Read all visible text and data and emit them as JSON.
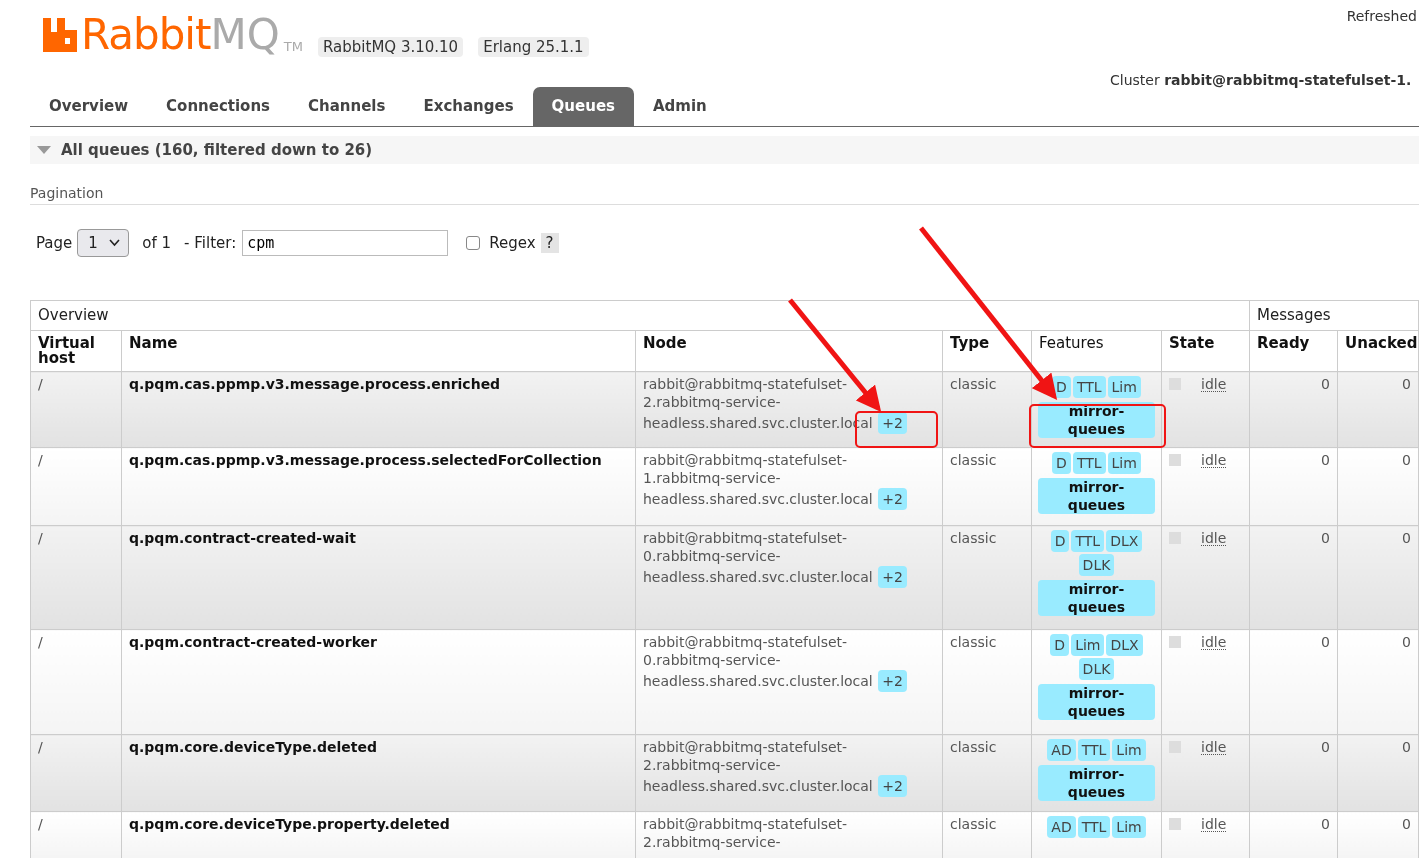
{
  "header": {
    "logo": {
      "brand": "Rabbit",
      "product": "MQ",
      "tm": "TM"
    },
    "versions": [
      "RabbitMQ 3.10.10",
      "Erlang 25.1.1"
    ],
    "refreshed": "Refreshed",
    "cluster_label": "Cluster",
    "cluster_name": "rabbit@rabbitmq-statefulset-1."
  },
  "tabs": [
    {
      "label": "Overview",
      "selected": false
    },
    {
      "label": "Connections",
      "selected": false
    },
    {
      "label": "Channels",
      "selected": false
    },
    {
      "label": "Exchanges",
      "selected": false
    },
    {
      "label": "Queues",
      "selected": true
    },
    {
      "label": "Admin",
      "selected": false
    }
  ],
  "section": {
    "title": "All queues (160, filtered down to 26)",
    "expanded": true
  },
  "pagination": {
    "heading": "Pagination",
    "page_label": "Page",
    "page_value": "1",
    "of_label": "of 1",
    "filter_label": "- Filter:",
    "filter_value": "cpm",
    "regex_label": "Regex",
    "regex_checked": false,
    "help": "?"
  },
  "table": {
    "groups": [
      {
        "label": "Overview"
      },
      {
        "label": "Messages"
      }
    ],
    "columns": [
      {
        "label": "Virtual host",
        "bold": true
      },
      {
        "label": "Name",
        "bold": true
      },
      {
        "label": "Node",
        "bold": true
      },
      {
        "label": "Type",
        "bold": true
      },
      {
        "label": "Features",
        "bold": false
      },
      {
        "label": "State",
        "bold": true
      },
      {
        "label": "Ready",
        "bold": true
      },
      {
        "label": "Unacked",
        "bold": true
      }
    ],
    "rows": [
      {
        "vhost": "/",
        "name": "q.pqm.cas.ppmp.v3.message.process.enriched",
        "node": "rabbit@rabbitmq-statefulset-2.rabbitmq-service-headless.shared.svc.cluster.local",
        "node_extra": "+2",
        "type": "classic",
        "features": [
          "D",
          "TTL",
          "Lim"
        ],
        "policy": "mirror-queues",
        "state": "idle",
        "ready": "0",
        "unacked": "0"
      },
      {
        "vhost": "/",
        "name": "q.pqm.cas.ppmp.v3.message.process.selectedForCollection",
        "node": "rabbit@rabbitmq-statefulset-1.rabbitmq-service-headless.shared.svc.cluster.local",
        "node_extra": "+2",
        "type": "classic",
        "features": [
          "D",
          "TTL",
          "Lim"
        ],
        "policy": "mirror-queues",
        "state": "idle",
        "ready": "0",
        "unacked": "0"
      },
      {
        "vhost": "/",
        "name": "q.pqm.contract-created-wait",
        "node": "rabbit@rabbitmq-statefulset-0.rabbitmq-service-headless.shared.svc.cluster.local",
        "node_extra": "+2",
        "type": "classic",
        "features": [
          "D",
          "TTL",
          "DLX",
          "DLK"
        ],
        "policy": "mirror-queues",
        "state": "idle",
        "ready": "0",
        "unacked": "0"
      },
      {
        "vhost": "/",
        "name": "q.pqm.contract-created-worker",
        "node": "rabbit@rabbitmq-statefulset-0.rabbitmq-service-headless.shared.svc.cluster.local",
        "node_extra": "+2",
        "type": "classic",
        "features": [
          "D",
          "Lim",
          "DLX",
          "DLK"
        ],
        "policy": "mirror-queues",
        "state": "idle",
        "ready": "0",
        "unacked": "0"
      },
      {
        "vhost": "/",
        "name": "q.pqm.core.deviceType.deleted",
        "node": "rabbit@rabbitmq-statefulset-2.rabbitmq-service-headless.shared.svc.cluster.local",
        "node_extra": "+2",
        "type": "classic",
        "features": [
          "AD",
          "TTL",
          "Lim"
        ],
        "policy": "mirror-queues",
        "state": "idle",
        "ready": "0",
        "unacked": "0"
      },
      {
        "vhost": "/",
        "name": "q.pqm.core.deviceType.property.deleted",
        "node": "rabbit@rabbitmq-statefulset-2.rabbitmq-service-",
        "type": "classic",
        "features": [
          "AD",
          "TTL",
          "Lim"
        ],
        "state": "idle",
        "ready": "0",
        "unacked": "0"
      }
    ]
  }
}
